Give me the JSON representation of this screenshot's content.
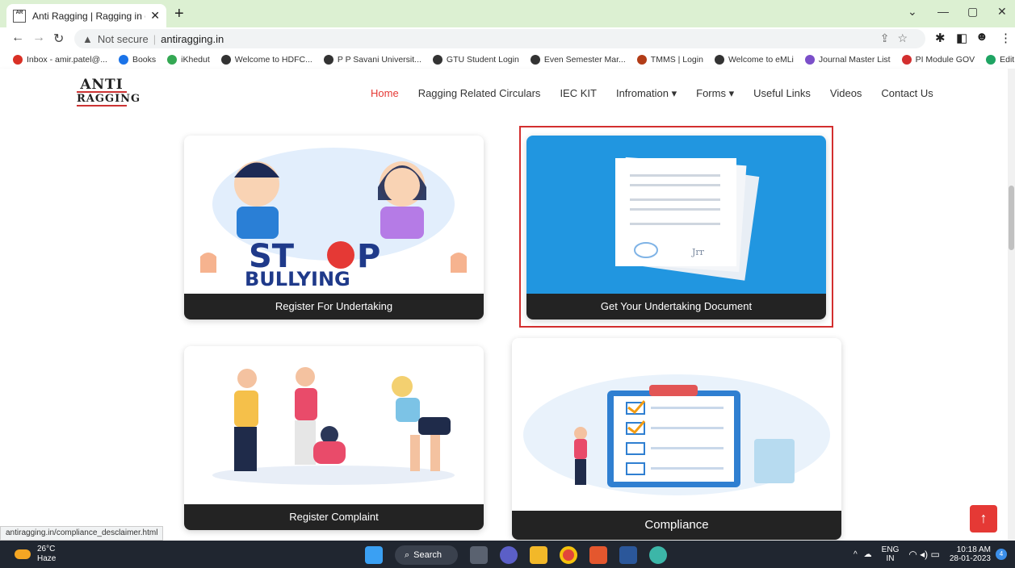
{
  "browser": {
    "tab_title": "Anti Ragging | Ragging in college",
    "security_label": "Not secure",
    "url": "antiragging.in",
    "status_url": "antiragging.in/compliance_desclaimer.html"
  },
  "bookmarks": [
    {
      "label": "Inbox - amir.patel@...",
      "color": "#d93025"
    },
    {
      "label": "Books",
      "color": "#1a73e8"
    },
    {
      "label": "iKhedut",
      "color": "#34a853"
    },
    {
      "label": "Welcome to HDFC...",
      "color": "#333333"
    },
    {
      "label": "P P Savani Universit...",
      "color": "#333333"
    },
    {
      "label": "GTU Student Login",
      "color": "#333333"
    },
    {
      "label": "Even Semester Mar...",
      "color": "#333333"
    },
    {
      "label": "TMMS | Login",
      "color": "#b23c17"
    },
    {
      "label": "Welcome to eMLi",
      "color": "#333333"
    },
    {
      "label": "Journal Master List",
      "color": "#7b4fc9"
    },
    {
      "label": "PI Module GOV",
      "color": "#d32f2f"
    },
    {
      "label": "Edit PDF",
      "color": "#1fa463"
    }
  ],
  "site": {
    "logo_line1": "ANTI",
    "logo_line2": "RAGGING",
    "menu": [
      "Home",
      "Ragging Related Circulars",
      "IEC KIT",
      "Infromation ▾",
      "Forms ▾",
      "Useful Links",
      "Videos",
      "Contact Us"
    ]
  },
  "cards": {
    "register_undertaking": "Register For Undertaking",
    "stop_word1": "ST",
    "stop_word2": "P",
    "bullying_word": "BULLYING",
    "get_document": "Get Your Undertaking Document",
    "register_complaint": "Register Complaint",
    "compliance": "Compliance"
  },
  "taskbar": {
    "temp": "26°C",
    "weather": "Haze",
    "search_label": "Search",
    "lang1": "ENG",
    "lang2": "IN",
    "time": "10:18 AM",
    "date": "28-01-2023",
    "notif_count": "4"
  }
}
